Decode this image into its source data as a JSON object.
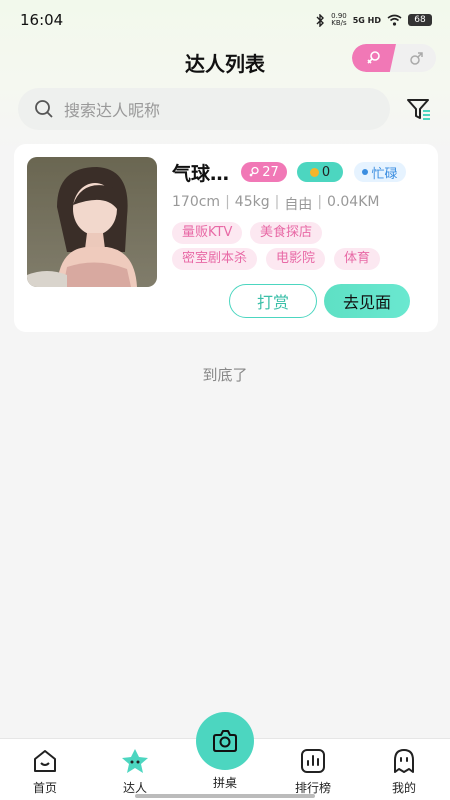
{
  "status_bar": {
    "time": "16:04",
    "speed_value": "0.90",
    "speed_unit": "KB/s",
    "network": "5G HD",
    "battery": "68"
  },
  "header": {
    "title": "达人列表",
    "gender_female_icon": "female-symbol-icon",
    "gender_male_icon": "male-symbol-icon"
  },
  "search": {
    "placeholder": "搜索达人昵称"
  },
  "card": {
    "name": "气球…",
    "age": "27",
    "coins": "0",
    "status": "忙碌",
    "height": "170cm",
    "weight": "45kg",
    "job": "自由",
    "distance": "0.04KM",
    "tags": [
      "量贩KTV",
      "美食探店",
      "密室剧本杀",
      "电影院",
      "体育"
    ],
    "tip_button": "打赏",
    "meet_button": "去见面"
  },
  "end_text": "到底了",
  "tabs": {
    "home": "首页",
    "talent": "达人",
    "table": "拼桌",
    "ranking": "排行榜",
    "mine": "我的"
  },
  "colors": {
    "accent_teal": "#4cd6c0",
    "accent_pink": "#f178b6"
  }
}
